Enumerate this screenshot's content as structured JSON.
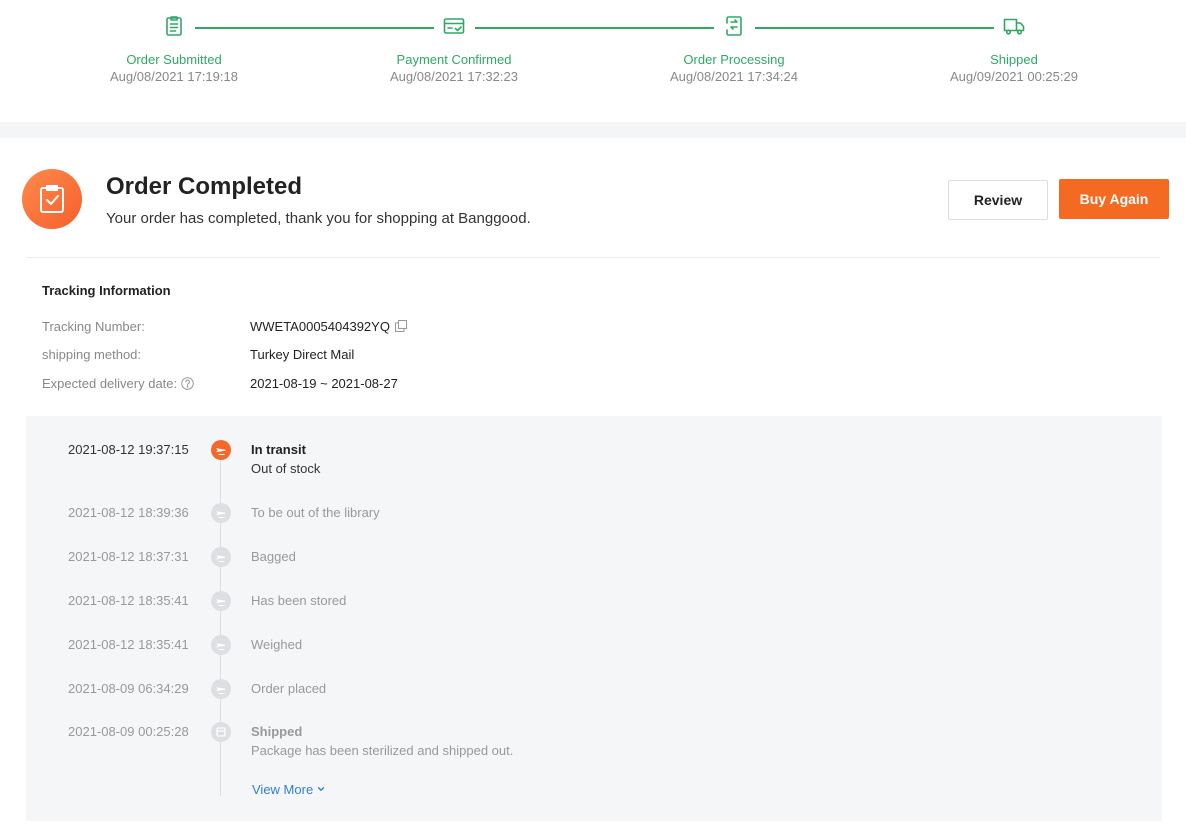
{
  "progress": {
    "steps": [
      {
        "icon": "clipboard-list-icon",
        "name": "Order Submitted",
        "time": "Aug/08/2021 17:19:18"
      },
      {
        "icon": "credit-card-check-icon",
        "name": "Payment Confirmed",
        "time": "Aug/08/2021 17:32:23"
      },
      {
        "icon": "processing-arrows-icon",
        "name": "Order Processing",
        "time": "Aug/08/2021 17:34:24"
      },
      {
        "icon": "truck-icon",
        "name": "Shipped",
        "time": "Aug/09/2021 00:25:29"
      }
    ],
    "accent_color": "#2fa866"
  },
  "order_status": {
    "icon": "clipboard-check-icon",
    "title": "Order Completed",
    "subtitle": "Your order has completed, thank you for shopping at Banggood.",
    "review_label": "Review",
    "buy_again_label": "Buy Again",
    "buy_again_color": "#f56a22"
  },
  "tracking": {
    "title": "Tracking Information",
    "tracking_number_label": "Tracking Number:",
    "tracking_number": "WWETA0005404392YQ",
    "shipping_method_label": "shipping method:",
    "shipping_method": "Turkey Direct Mail",
    "delivery_label": "Expected delivery date:",
    "delivery_date": "2021-08-19 ~ 2021-08-27"
  },
  "timeline": {
    "events": [
      {
        "time": "2021-08-12 19:37:15",
        "status": "In transit",
        "desc": "Out of stock",
        "icon": "plane-icon",
        "active": true
      },
      {
        "time": "2021-08-12 18:39:36",
        "status": "To be out of the library",
        "desc": "",
        "icon": "plane-icon",
        "active": false
      },
      {
        "time": "2021-08-12 18:37:31",
        "status": "Bagged",
        "desc": "",
        "icon": "plane-icon",
        "active": false
      },
      {
        "time": "2021-08-12 18:35:41",
        "status": "Has been stored",
        "desc": "",
        "icon": "plane-icon",
        "active": false
      },
      {
        "time": "2021-08-12 18:35:41",
        "status": "Weighed",
        "desc": "",
        "icon": "plane-icon",
        "active": false
      },
      {
        "time": "2021-08-09 06:34:29",
        "status": "Order placed",
        "desc": "",
        "icon": "plane-icon",
        "active": false
      },
      {
        "time": "2021-08-09 00:25:28",
        "status": "Shipped",
        "desc": "Package has been sterilized and shipped out.",
        "icon": "box-icon",
        "active": false
      }
    ],
    "view_more_label": "View More"
  }
}
